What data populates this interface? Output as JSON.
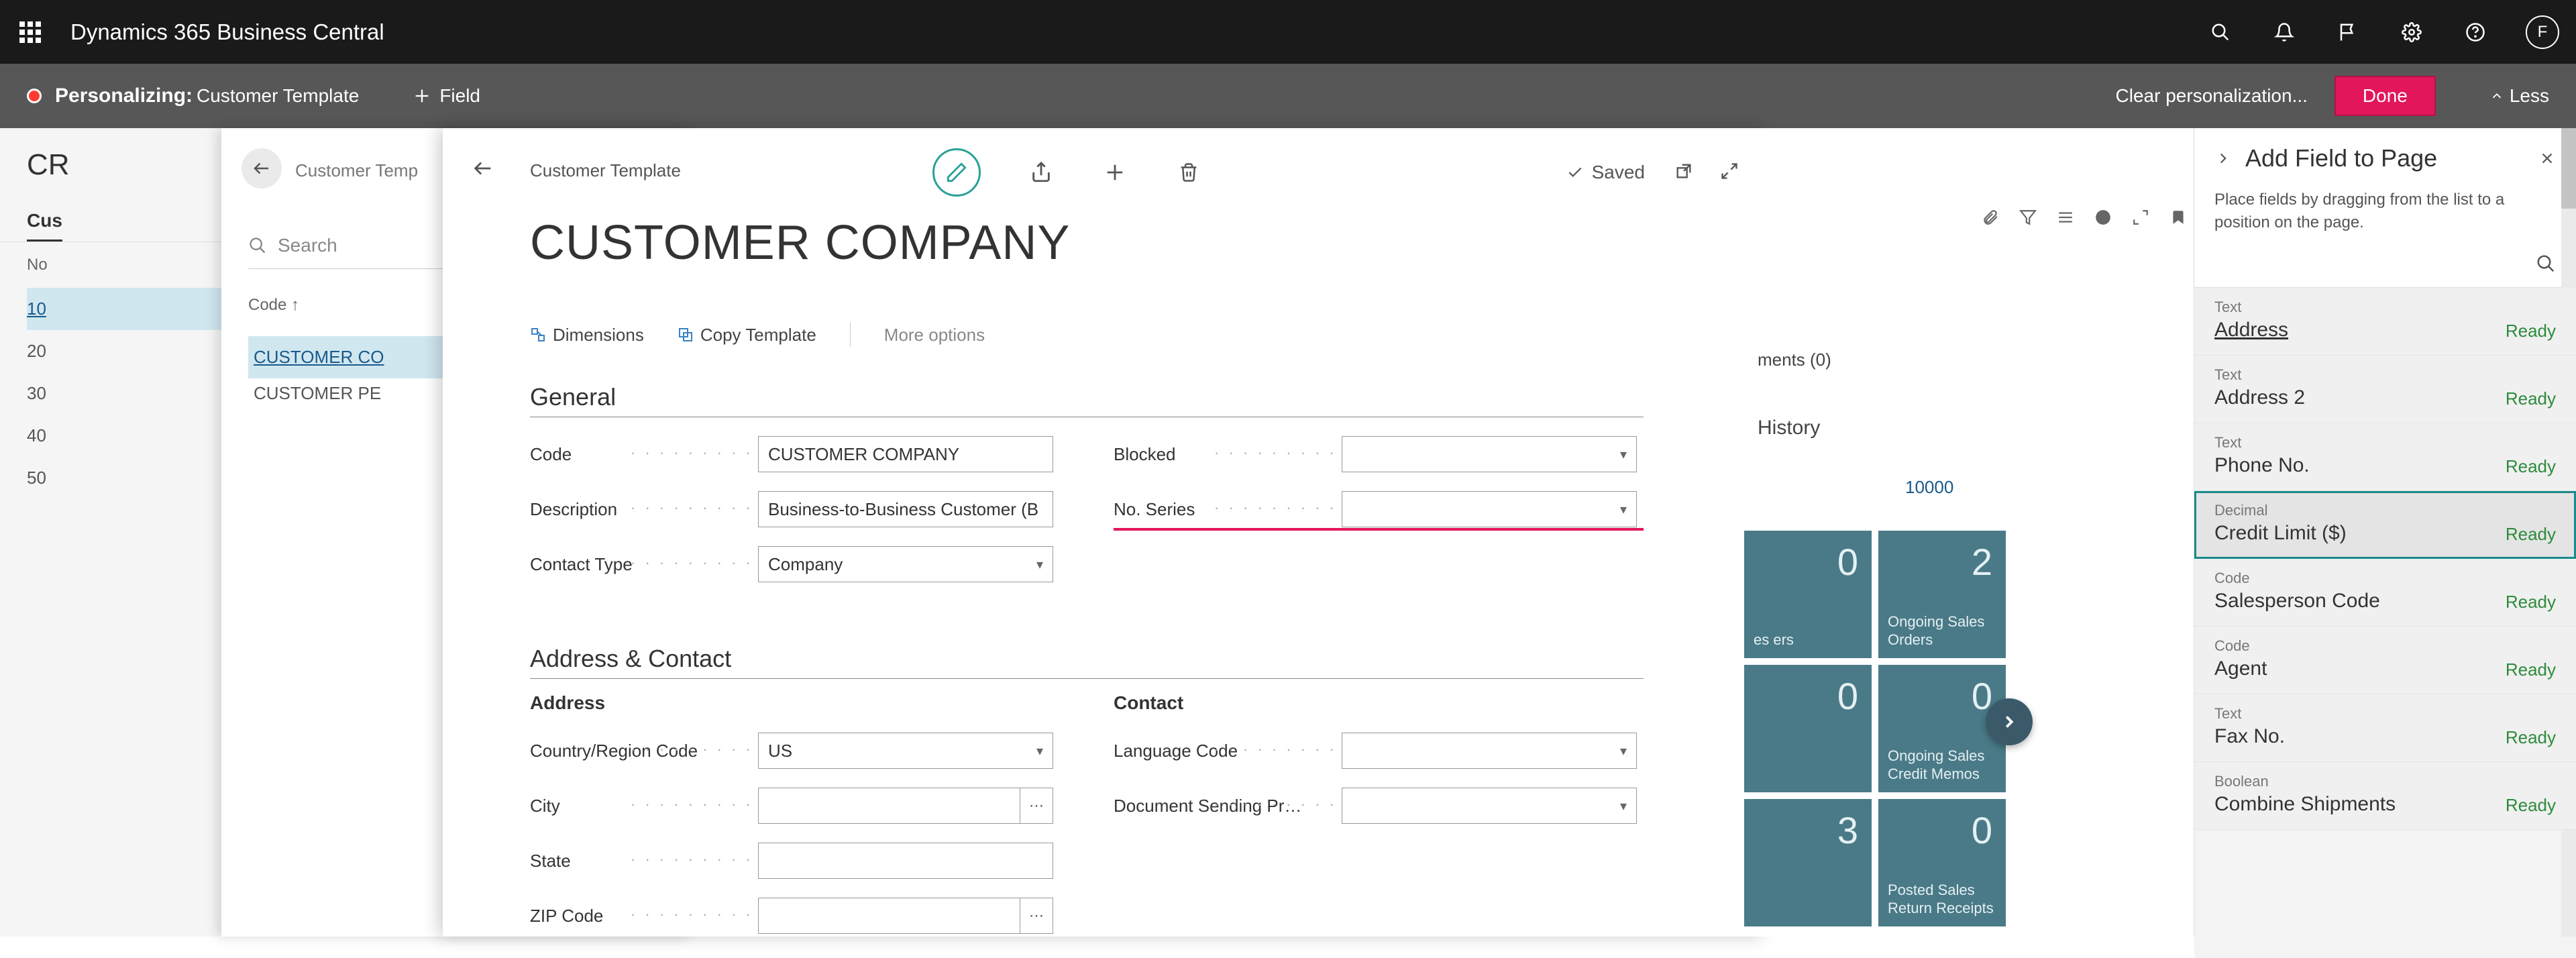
{
  "topbar": {
    "brand": "Dynamics 365 Business Central",
    "avatar_initial": "F"
  },
  "persbar": {
    "title": "Personalizing:",
    "subtitle": "Customer Template",
    "add_field": "+ Field",
    "clear": "Clear personalization...",
    "done": "Done",
    "less": "Less"
  },
  "bglayer1": {
    "title": "CR",
    "tab": "Cus",
    "col": "No",
    "rows": [
      "10",
      "20",
      "30",
      "40",
      "50"
    ]
  },
  "bglayer2": {
    "crumb": "Customer Temp",
    "search_placeholder": "Search",
    "col": "Code ↑",
    "rows": [
      "CUSTOMER CO",
      "CUSTOMER PE"
    ]
  },
  "card": {
    "crumb": "Customer Template",
    "title": "CUSTOMER COMPANY",
    "saved": "Saved",
    "cmd_dimensions": "Dimensions",
    "cmd_copy": "Copy Template",
    "cmd_more": "More options",
    "sec_general": "General",
    "sec_addr": "Address & Contact",
    "sub_address": "Address",
    "sub_contact": "Contact",
    "fields": {
      "code_label": "Code",
      "code_value": "CUSTOMER COMPANY",
      "desc_label": "Description",
      "desc_value": "Business-to-Business Customer (B",
      "contact_type_label": "Contact Type",
      "contact_type_value": "Company",
      "blocked_label": "Blocked",
      "blocked_value": "",
      "noseries_label": "No. Series",
      "noseries_value": "",
      "country_label": "Country/Region Code",
      "country_value": "US",
      "city_label": "City",
      "city_value": "",
      "state_label": "State",
      "state_value": "",
      "zip_label": "ZIP Code",
      "zip_value": "",
      "lang_label": "Language Code",
      "lang_value": "",
      "docsend_label": "Document Sending Pr…",
      "docsend_value": ""
    }
  },
  "bgright": {
    "attachments": "ments (0)",
    "history": "History",
    "cust_no": "10000",
    "tiles": [
      {
        "num": "0",
        "cap": "es\ners"
      },
      {
        "num": "2",
        "cap": "Ongoing Sales Orders"
      },
      {
        "num": "0",
        "cap": ""
      },
      {
        "num": "0",
        "cap": "Ongoing Sales Credit Memos"
      },
      {
        "num": "3",
        "cap": ""
      },
      {
        "num": "0",
        "cap": "Posted Sales Return Receipts"
      }
    ]
  },
  "addpanel": {
    "title": "Add Field to Page",
    "desc": "Place fields by dragging from the list to a position on the page.",
    "items": [
      {
        "type": "Text",
        "name": "Address",
        "ready": "Ready",
        "underline": true
      },
      {
        "type": "Text",
        "name": "Address 2",
        "ready": "Ready"
      },
      {
        "type": "Text",
        "name": "Phone No.",
        "ready": "Ready"
      },
      {
        "type": "Decimal",
        "name": "Credit Limit ($)",
        "ready": "Ready",
        "selected": true
      },
      {
        "type": "Code",
        "name": "Salesperson Code",
        "ready": "Ready"
      },
      {
        "type": "Code",
        "name": "Agent",
        "ready": "Ready"
      },
      {
        "type": "Text",
        "name": "Fax No.",
        "ready": "Ready"
      },
      {
        "type": "Boolean",
        "name": "Combine Shipments",
        "ready": "Ready"
      }
    ]
  }
}
